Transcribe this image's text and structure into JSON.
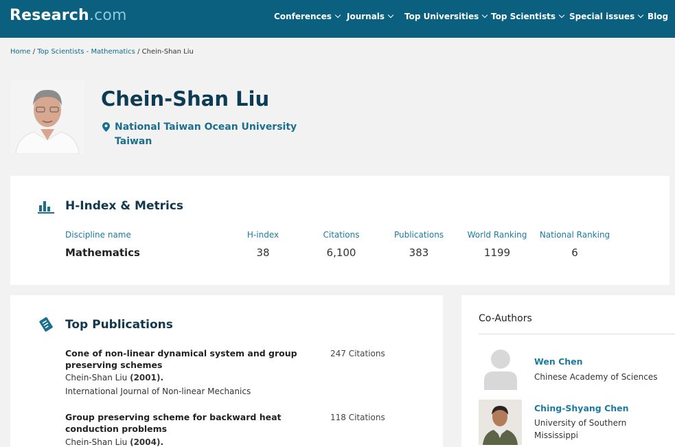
{
  "header": {
    "logo_main": "Research",
    "logo_domain": ".com",
    "nav": [
      {
        "label": "Conferences",
        "dropdown": true
      },
      {
        "label": "Journals",
        "dropdown": true
      },
      {
        "label": "Top Universities",
        "dropdown": true
      },
      {
        "label": "Top Scientists",
        "dropdown": true
      },
      {
        "label": "Special issues",
        "dropdown": true
      },
      {
        "label": "Blog",
        "dropdown": false
      }
    ]
  },
  "breadcrumb": {
    "home": "Home",
    "sep1": " / ",
    "section": "Top Scientists - Mathematics",
    "sep2": " / ",
    "current": "Chein-Shan Liu"
  },
  "profile": {
    "name": "Chein-Shan Liu",
    "institution": "National Taiwan Ocean University",
    "country": "Taiwan"
  },
  "metrics": {
    "title": "H-Index & Metrics",
    "headers": {
      "discipline": "Discipline name",
      "hindex": "H-index",
      "citations": "Citations",
      "publications": "Publications",
      "world_ranking": "World Ranking",
      "national_ranking": "National Ranking"
    },
    "row": {
      "discipline": "Mathematics",
      "hindex": "38",
      "citations": "6,100",
      "publications": "383",
      "world_ranking": "1199",
      "national_ranking": "6"
    }
  },
  "publications": {
    "title": "Top Publications",
    "items": [
      {
        "title": "Cone of non-linear dynamical system and group preserving schemes",
        "citations": "247 Citations",
        "author": "Chein-Shan Liu",
        "year": "(2001).",
        "venue": "International Journal of Non-linear Mechanics"
      },
      {
        "title": "Group preserving scheme for backward heat conduction problems",
        "citations": "118 Citations",
        "author": "Chein-Shan Liu",
        "year": "(2004).",
        "venue": ""
      }
    ]
  },
  "coauthors": {
    "title": "Co-Authors",
    "items": [
      {
        "name": "Wen Chen",
        "affiliation": "Chinese Academy of Sciences"
      },
      {
        "name": "Ching-Shyang Chen",
        "affiliation": "University of Southern Mississippi"
      }
    ]
  },
  "colors": {
    "header_bg": "#0b6080",
    "link": "#1b7aa2",
    "name": "#0d3b54"
  }
}
